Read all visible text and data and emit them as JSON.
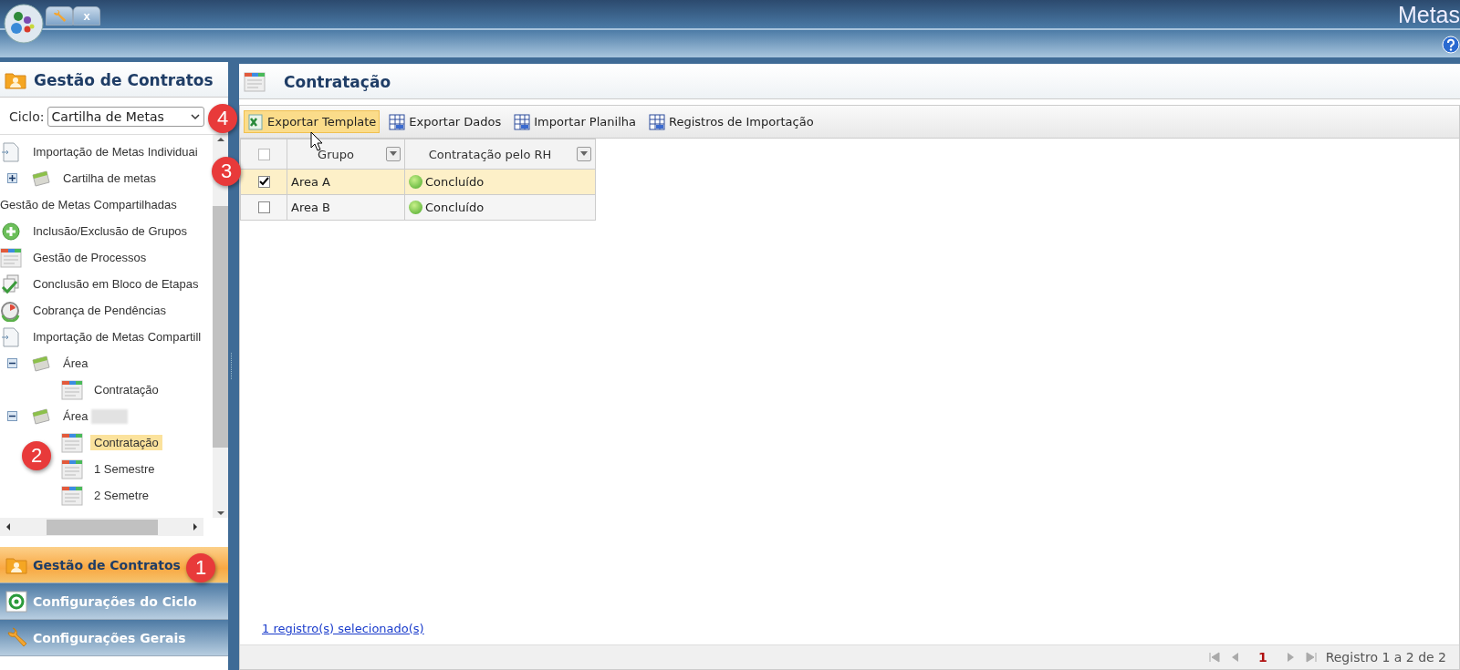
{
  "app_header": {
    "title": "Metas",
    "tabs": [
      {
        "kind": "wrench"
      },
      {
        "kind": "close",
        "label": "x"
      }
    ]
  },
  "left_panel": {
    "title": "Gestão de Contratos",
    "cycle_label": "Ciclo:",
    "cycle_value": "Cartilha de Metas",
    "tree": [
      {
        "label": "Importação de Metas Individuai",
        "kind": "doc",
        "selected": false
      },
      {
        "label": "Cartilha de metas",
        "kind": "calendar",
        "expanded": false,
        "selected": false
      },
      {
        "label": "Gestão de Metas Compartilhadas",
        "kind": "heading",
        "selected": false
      },
      {
        "label": "Inclusão/Exclusão de Grupos",
        "kind": "plus",
        "selected": false
      },
      {
        "label": "Gestão de Processos",
        "kind": "sheet",
        "selected": false
      },
      {
        "label": "Conclusão em Bloco de Etapas",
        "kind": "check",
        "selected": false
      },
      {
        "label": "Cobrança de Pendências",
        "kind": "clock",
        "selected": false
      },
      {
        "label": "Importação de Metas Compartill",
        "kind": "doc",
        "selected": false
      },
      {
        "label": "Área",
        "kind": "calendar",
        "expanded": true,
        "selected": false,
        "children": [
          {
            "label": "Contratação",
            "kind": "sheet",
            "selected": false
          }
        ]
      },
      {
        "label": "Área",
        "kind": "calendar",
        "expanded": true,
        "selected": false,
        "redacted": true,
        "children": [
          {
            "label": "Contratação",
            "kind": "sheet",
            "selected": true
          },
          {
            "label": "1 Semestre",
            "kind": "sheet",
            "selected": false
          },
          {
            "label": "2 Semetre",
            "kind": "sheet",
            "selected": false
          }
        ]
      }
    ],
    "accordion": [
      {
        "label": "Gestão de Contratos",
        "kind": "folder",
        "selected": true
      },
      {
        "label": "Configurações do Ciclo",
        "kind": "cycle",
        "selected": false
      },
      {
        "label": "Configurações Gerais",
        "kind": "wrench",
        "selected": false
      }
    ]
  },
  "main_panel": {
    "title": "Contratação",
    "toolbar": [
      {
        "label": "Exportar Template",
        "kind": "excel",
        "selected": true
      },
      {
        "label": "Exportar Dados",
        "kind": "grid",
        "selected": false
      },
      {
        "label": "Importar Planilha",
        "kind": "grid",
        "selected": false
      },
      {
        "label": "Registros de Importação",
        "kind": "grid",
        "selected": false
      }
    ],
    "table": {
      "all_checked": false,
      "columns": [
        "Grupo",
        "Contratação pelo RH"
      ],
      "rows": [
        {
          "checked": true,
          "selected": true,
          "cells": [
            "Area A",
            "Concluído"
          ]
        },
        {
          "checked": false,
          "selected": false,
          "cells": [
            "Area B",
            "Concluído"
          ]
        }
      ]
    },
    "selection_link": "1 registro(s) selecionado(s)",
    "pager": {
      "page": "1",
      "summary": "Registro 1 a 2 de 2"
    }
  },
  "callouts": [
    "1",
    "2",
    "3",
    "4"
  ]
}
